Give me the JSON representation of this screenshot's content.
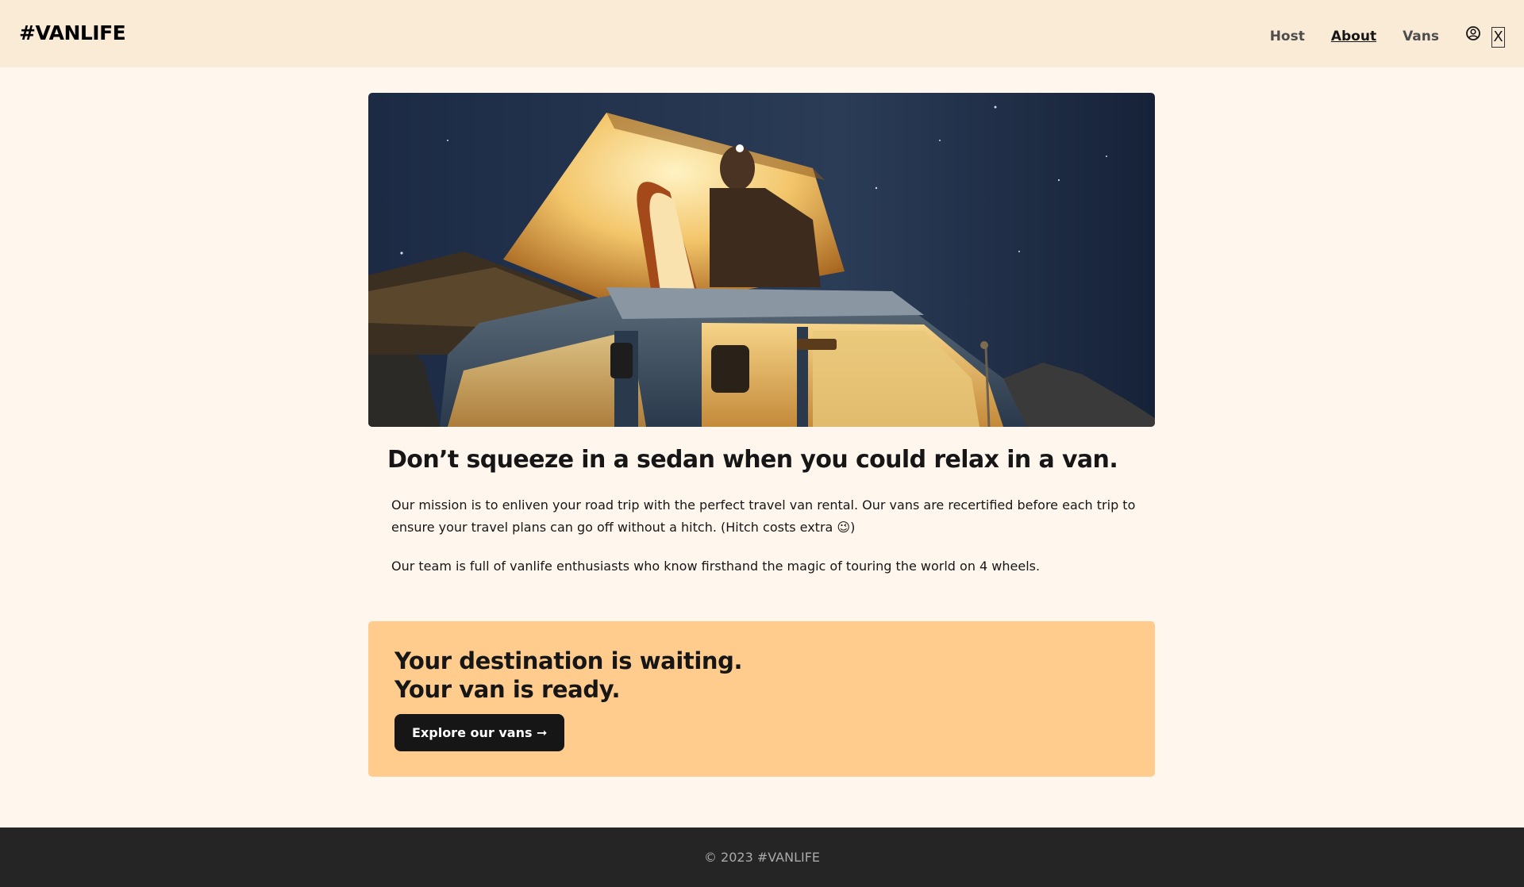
{
  "header": {
    "logo": "#VANLIFE",
    "nav": [
      {
        "label": "Host",
        "active": false
      },
      {
        "label": "About",
        "active": true
      },
      {
        "label": "Vans",
        "active": false
      }
    ],
    "user_icon": "user-circle-icon",
    "close_label": "X"
  },
  "hero": {
    "image": "van-at-night-image"
  },
  "content": {
    "headline": "Don’t squeeze in a sedan when you could relax in a van.",
    "paragraphs": [
      "Our mission is to enliven your road trip with the perfect travel van rental. Our vans are recertified before each trip to ensure your travel plans can go off without a hitch. (Hitch costs extra 😉)",
      "Our team is full of vanlife enthusiasts who know firsthand the magic of touring the world on 4 wheels."
    ]
  },
  "cta": {
    "line1": "Your destination is waiting.",
    "line2": "Your van is ready.",
    "button_label": "Explore our vans ➞"
  },
  "footer": {
    "text": "© 2023 #VANLIFE"
  },
  "colors": {
    "page_bg": "#FFF7ED",
    "header_bg": "#FAEBD7",
    "cta_bg": "#FFCC8D",
    "button_bg": "#161616",
    "footer_bg": "#252525"
  }
}
